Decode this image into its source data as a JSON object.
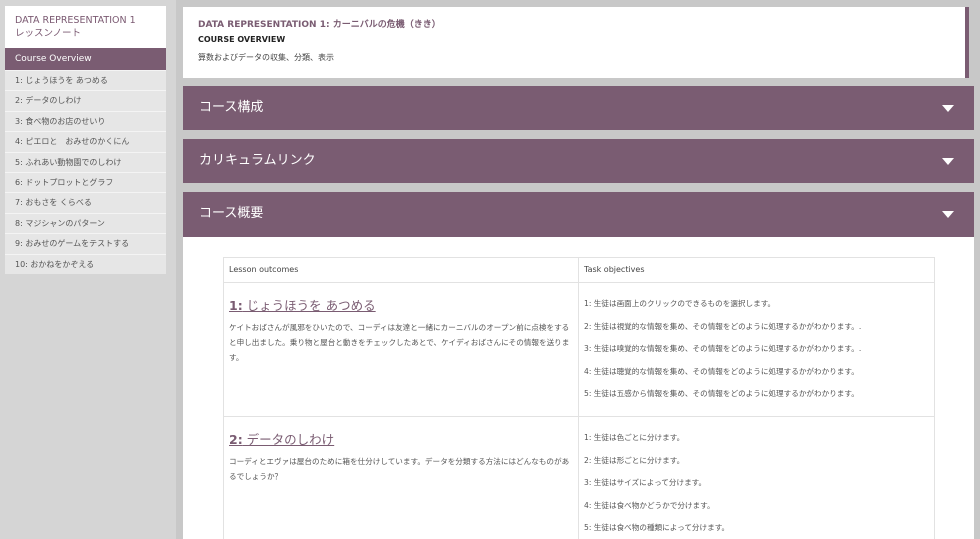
{
  "sidebar": {
    "title_line1": "DATA REPRESENTATION 1",
    "title_line2": "レッスンノート",
    "items": [
      {
        "label": "Course Overview"
      },
      {
        "label": "1: じょうほうを あつめる"
      },
      {
        "label": "2: データのしわけ"
      },
      {
        "label": "3: 食べ物のお店のせいり"
      },
      {
        "label": "4: ピエロと　おみせのかくにん"
      },
      {
        "label": "5: ふれあい動物園でのしわけ"
      },
      {
        "label": "6: ドットプロットとグラフ"
      },
      {
        "label": "7: おもさを くらべる"
      },
      {
        "label": "8: マジシャンのパターン"
      },
      {
        "label": "9: おみせのゲームをテストする"
      },
      {
        "label": "10: おかねをかぞえる"
      }
    ]
  },
  "header": {
    "title": "DATA REPRESENTATION 1: カーニバルの危機（きき）",
    "subtitle": "COURSE OVERVIEW",
    "description": "算数およびデータの収集、分類、表示"
  },
  "accordions": [
    {
      "label": "コース構成"
    },
    {
      "label": "カリキュラムリンク"
    },
    {
      "label": "コース概要"
    }
  ],
  "table": {
    "col_lesson": "Lesson outcomes",
    "col_tasks": "Task objectives",
    "lessons": [
      {
        "num": "1:",
        "title": " じょうほうを あつめる",
        "text": "ケイトおばさんが風邪をひいたので、コーディは友達と一緒にカーニバルのオープン前に点検をすると申し出ました。乗り物と屋台と動きをチェックしたあとで、ケイディおばさんにその情報を送ります。",
        "objectives": [
          "1: 生徒は画面上のクリックのできるものを選択します。",
          "2: 生徒は視覚的な情報を集め、その情報をどのように処理するかがわかります。.",
          "3: 生徒は嗅覚的な情報を集め、その情報をどのように処理するかがわかります。.",
          "4: 生徒は聴覚的な情報を集め、その情報をどのように処理するかがわかります。",
          "5: 生徒は五感から情報を集め、その情報をどのように処理するかがわかります。"
        ]
      },
      {
        "num": "2:",
        "title": " データのしわけ",
        "text": "コーディとエヴァは屋台のために箱を仕分けしています。データを分類する方法にはどんなものがあるでしょうか？",
        "objectives": [
          "1: 生徒は色ごとに分けます。",
          "2: 生徒は形ごとに分けます。",
          "3: 生徒はサイズによって分けます。",
          "4: 生徒は食べ物かどうかで分けます。",
          "5: 生徒は食べ物の種類によって分けます。"
        ]
      }
    ]
  },
  "colors": {
    "accent": "#7a5c72",
    "background": "#d5d5d5"
  }
}
